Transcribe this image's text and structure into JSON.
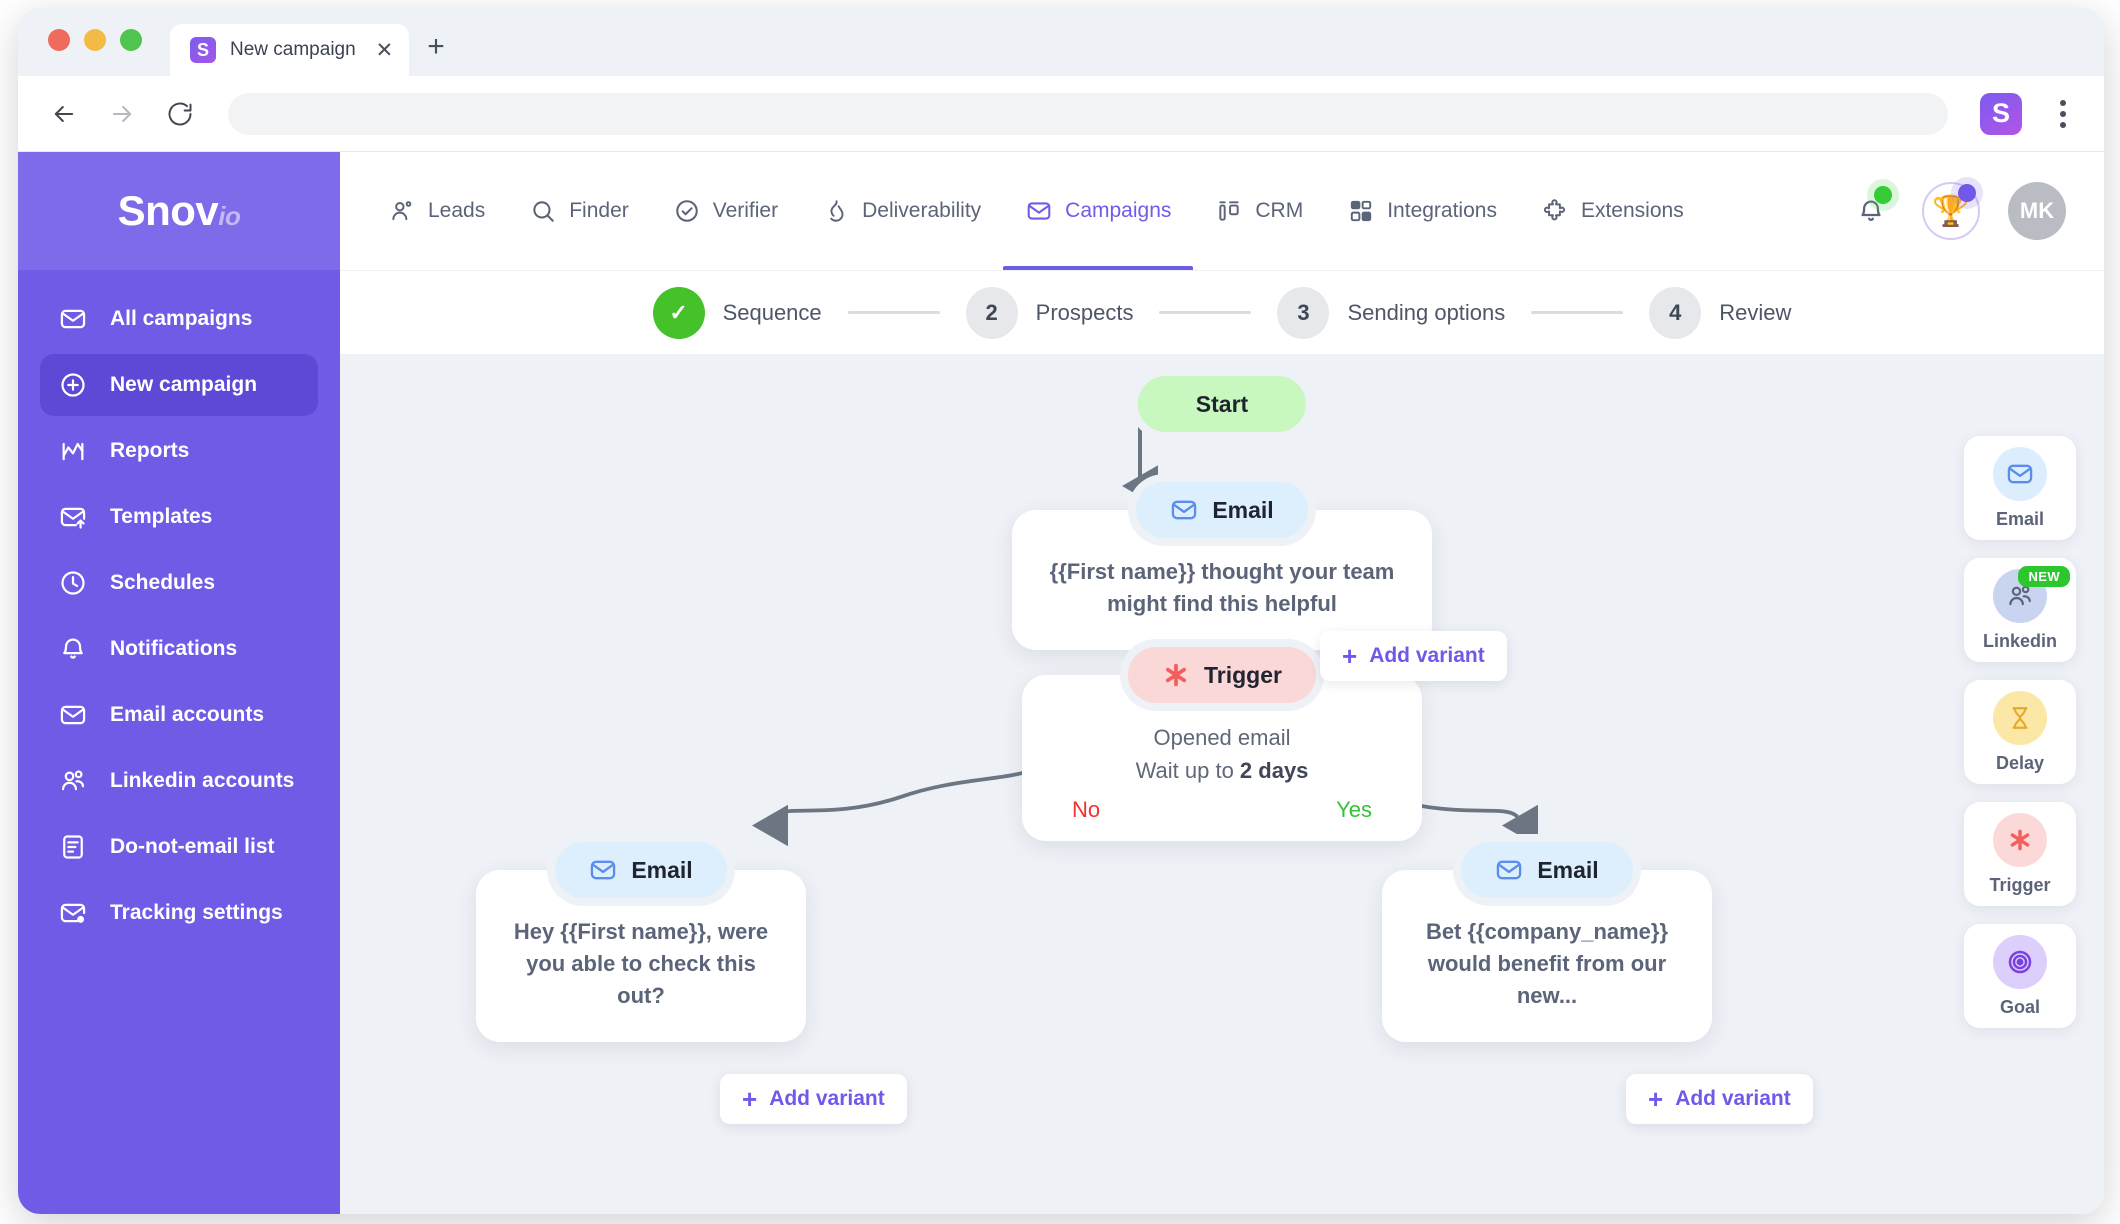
{
  "browser": {
    "tab": {
      "title": "New campaign",
      "favicon_letter": "S",
      "close_icon": "close-icon"
    },
    "new_tab_label": "+",
    "address_value": "",
    "address_placeholder": "",
    "extension_letter": "S"
  },
  "sidebar": {
    "logo_main": "Snov",
    "logo_suffix": "io",
    "items": [
      {
        "label": "All campaigns",
        "icon": "envelope-icon",
        "active": false
      },
      {
        "label": "New campaign",
        "icon": "plus-circle-icon",
        "active": true
      },
      {
        "label": "Reports",
        "icon": "chart-icon",
        "active": false
      },
      {
        "label": "Templates",
        "icon": "envelope-up-icon",
        "active": false
      },
      {
        "label": "Schedules",
        "icon": "clock-icon",
        "active": false
      },
      {
        "label": "Notifications",
        "icon": "bell-icon",
        "active": false
      },
      {
        "label": "Email accounts",
        "icon": "envelope-icon",
        "active": false
      },
      {
        "label": "Linkedin accounts",
        "icon": "people-icon",
        "active": false
      },
      {
        "label": "Do-not-email list",
        "icon": "document-list-icon",
        "active": false
      },
      {
        "label": "Tracking settings",
        "icon": "envelope-dot-icon",
        "active": false
      }
    ]
  },
  "topnav": {
    "items": [
      {
        "label": "Leads",
        "icon": "person-add-icon",
        "active": false
      },
      {
        "label": "Finder",
        "icon": "search-icon",
        "active": false
      },
      {
        "label": "Verifier",
        "icon": "check-circle-icon",
        "active": false
      },
      {
        "label": "Deliverability",
        "icon": "flame-icon",
        "active": false
      },
      {
        "label": "Campaigns",
        "icon": "envelope-icon",
        "active": true
      },
      {
        "label": "CRM",
        "icon": "crm-icon",
        "active": false
      },
      {
        "label": "Integrations",
        "icon": "grid-icon",
        "active": false
      },
      {
        "label": "Extensions",
        "icon": "puzzle-icon",
        "active": false
      }
    ],
    "notifications_icon": "bell-icon",
    "achievements_icon": "trophy-icon",
    "achievements_glyph": "🏆",
    "avatar_initials": "MK"
  },
  "stepper": {
    "steps": [
      {
        "number": "✓",
        "label": "Sequence",
        "state": "done"
      },
      {
        "number": "2",
        "label": "Prospects",
        "state": "inactive"
      },
      {
        "number": "3",
        "label": "Sending options",
        "state": "inactive"
      },
      {
        "number": "4",
        "label": "Review",
        "state": "inactive"
      }
    ]
  },
  "flow": {
    "start": {
      "label": "Start"
    },
    "email_1": {
      "pill_label": "Email",
      "icon": "envelope-icon",
      "subject": "{{First name}} thought your team might find this helpful",
      "add_variant_label": "Add variant"
    },
    "trigger": {
      "pill_label": "Trigger",
      "icon": "asterisk-icon",
      "condition": "Opened email",
      "wait_prefix": "Wait up to ",
      "wait_value": "2 days",
      "no_label": "No",
      "yes_label": "Yes"
    },
    "email_no": {
      "pill_label": "Email",
      "icon": "envelope-icon",
      "subject": "Hey {{First name}}, were you able to check this out?",
      "add_variant_label": "Add variant"
    },
    "email_yes": {
      "pill_label": "Email",
      "icon": "envelope-icon",
      "subject": "Bet {{company_name}} would benefit from our new...",
      "add_variant_label": "Add variant"
    }
  },
  "palette": {
    "items": [
      {
        "label": "Email",
        "icon": "envelope-icon",
        "badge": ""
      },
      {
        "label": "Linkedin",
        "icon": "people-icon",
        "badge": "NEW"
      },
      {
        "label": "Delay",
        "icon": "hourglass-icon",
        "badge": ""
      },
      {
        "label": "Trigger",
        "icon": "asterisk-icon",
        "badge": ""
      },
      {
        "label": "Goal",
        "icon": "target-icon",
        "badge": ""
      }
    ]
  },
  "colors": {
    "brand_purple": "#6f5ce6",
    "accent_purple": "#7158e8",
    "start_green": "#c9f7c0",
    "email_blue": "#ddeffd",
    "trigger_pink": "#fbd8d8",
    "delay_yellow": "#fbe8a6",
    "goal_lilac": "#dccffb",
    "yes_green": "#35c335",
    "no_red": "#f2322f",
    "canvas_bg": "#eef1f6"
  }
}
